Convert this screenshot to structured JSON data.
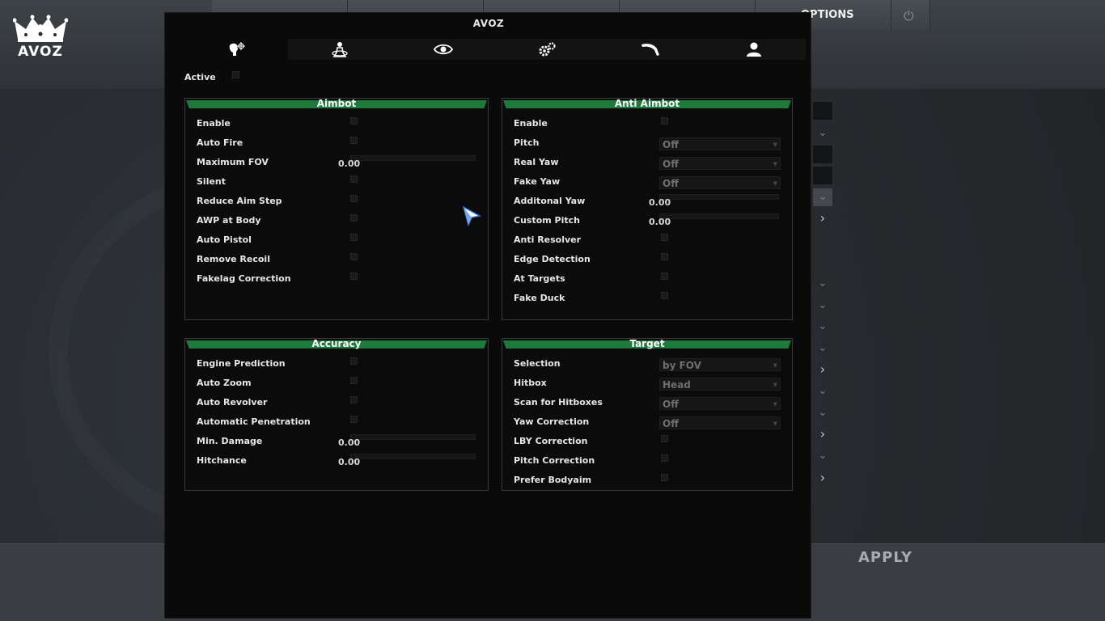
{
  "background": {
    "logo_text": "AVOZ",
    "options_label": "OPTIONS",
    "apply_label": "APPLY"
  },
  "menu": {
    "title": "AVOZ",
    "tabs": [
      {
        "icon": "aimbot-icon",
        "active": true
      },
      {
        "icon": "antiaim-icon",
        "active": false
      },
      {
        "icon": "visuals-icon",
        "active": false
      },
      {
        "icon": "misc-settings-icon",
        "active": false
      },
      {
        "icon": "skins-icon",
        "active": false
      },
      {
        "icon": "player-icon",
        "active": false
      }
    ],
    "active_label": "Active",
    "groups": {
      "aimbot": {
        "title": "Aimbot",
        "items": [
          {
            "label": "Enable",
            "type": "checkbox"
          },
          {
            "label": "Auto Fire",
            "type": "checkbox"
          },
          {
            "label": "Maximum FOV",
            "type": "slider",
            "value": "0.00"
          },
          {
            "label": "Silent",
            "type": "checkbox"
          },
          {
            "label": "Reduce Aim Step",
            "type": "checkbox"
          },
          {
            "label": "AWP at Body",
            "type": "checkbox"
          },
          {
            "label": "Auto Pistol",
            "type": "checkbox"
          },
          {
            "label": "Remove Recoil",
            "type": "checkbox"
          },
          {
            "label": "Fakelag Correction",
            "type": "checkbox"
          }
        ]
      },
      "anti_aimbot": {
        "title": "Anti Aimbot",
        "items": [
          {
            "label": "Enable",
            "type": "checkbox"
          },
          {
            "label": "Pitch",
            "type": "dropdown",
            "value": "Off"
          },
          {
            "label": "Real Yaw",
            "type": "dropdown",
            "value": "Off"
          },
          {
            "label": "Fake Yaw",
            "type": "dropdown",
            "value": "Off"
          },
          {
            "label": "Additonal Yaw",
            "type": "slider",
            "value": "0.00"
          },
          {
            "label": "Custom Pitch",
            "type": "slider",
            "value": "0.00"
          },
          {
            "label": "Anti Resolver",
            "type": "checkbox"
          },
          {
            "label": "Edge Detection",
            "type": "checkbox"
          },
          {
            "label": "At Targets",
            "type": "checkbox"
          },
          {
            "label": "Fake Duck",
            "type": "checkbox"
          }
        ]
      },
      "accuracy": {
        "title": "Accuracy",
        "items": [
          {
            "label": "Engine Prediction",
            "type": "checkbox"
          },
          {
            "label": "Auto Zoom",
            "type": "checkbox"
          },
          {
            "label": "Auto Revolver",
            "type": "checkbox"
          },
          {
            "label": "Automatic Penetration",
            "type": "checkbox"
          },
          {
            "label": "Min. Damage",
            "type": "slider",
            "value": "0.00"
          },
          {
            "label": "Hitchance",
            "type": "slider",
            "value": "0.00"
          }
        ]
      },
      "target": {
        "title": "Target",
        "items": [
          {
            "label": "Selection",
            "type": "dropdown",
            "value": "by FOV"
          },
          {
            "label": "Hitbox",
            "type": "dropdown",
            "value": "Head"
          },
          {
            "label": "Scan for Hitboxes",
            "type": "dropdown",
            "value": "Off"
          },
          {
            "label": "Yaw Correction",
            "type": "dropdown",
            "value": "Off"
          },
          {
            "label": "LBY Correction",
            "type": "checkbox"
          },
          {
            "label": "Pitch Correction",
            "type": "checkbox"
          },
          {
            "label": "Prefer Bodyaim",
            "type": "checkbox"
          }
        ]
      }
    }
  }
}
